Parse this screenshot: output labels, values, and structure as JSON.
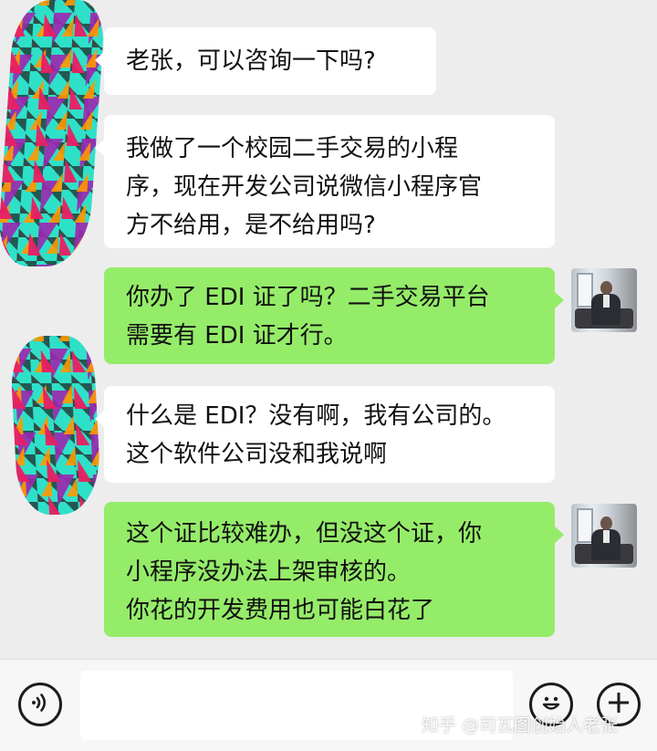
{
  "messages": [
    {
      "id": "m1",
      "side": "in",
      "text": "老张，可以咨询一下吗?"
    },
    {
      "id": "m2",
      "side": "in",
      "text": "我做了一个校园二手交易的小程\n序，现在开发公司说微信小程序官\n方不给用，是不给用吗?"
    },
    {
      "id": "m3",
      "side": "out",
      "text": "你办了 EDI 证了吗？二手交易平台\n需要有 EDI 证才行。"
    },
    {
      "id": "m4",
      "side": "in",
      "text": "什么是 EDI？没有啊，我有公司的。\n这个软件公司没和我说啊"
    },
    {
      "id": "m5",
      "side": "out",
      "text": "这个证比较难办，但没这个证，你\n小程序没办法上架审核的。\n你花的开发费用也可能白花了"
    }
  ],
  "input": {
    "value": "",
    "placeholder": ""
  },
  "watermark": "知乎 @司瓦图创始人老张",
  "colors": {
    "background": "#ededed",
    "incoming_bubble": "#ffffff",
    "outgoing_bubble": "#95ec69",
    "input_bar": "#f7f7f7"
  },
  "icons": {
    "voice": "voice-icon",
    "emoji": "emoji-icon",
    "plus": "plus-icon"
  }
}
